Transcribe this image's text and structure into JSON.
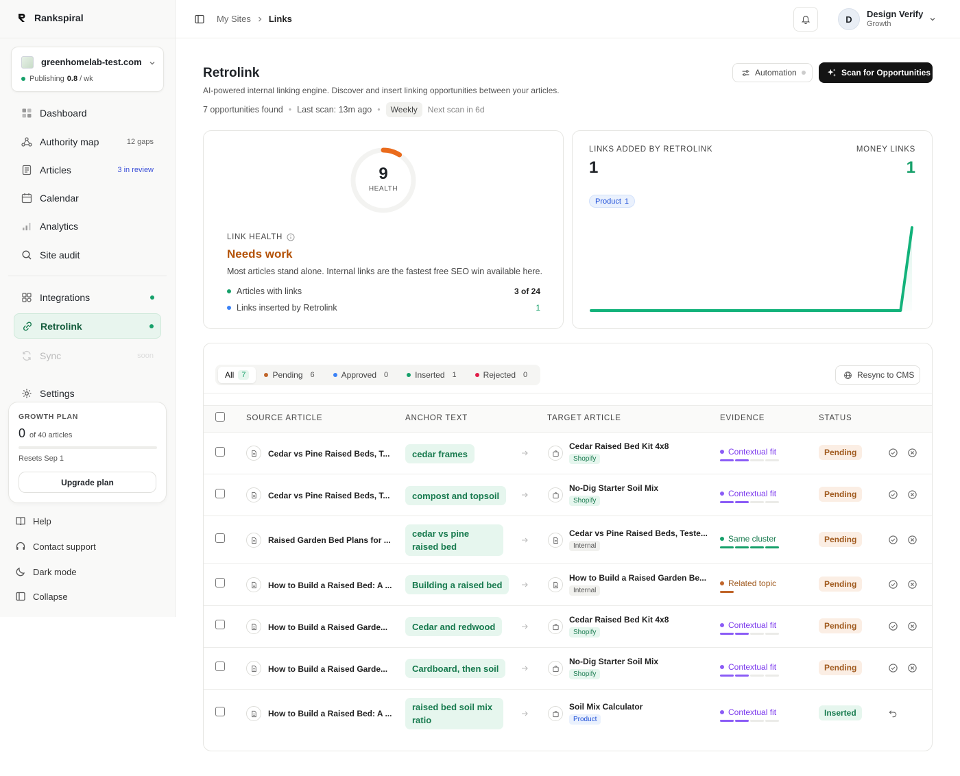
{
  "app": {
    "name": "Rankspiral"
  },
  "site": {
    "name": "greenhomelab-test.com",
    "publishing_label": "Publishing",
    "publishing_rate": "0.8",
    "publishing_unit": "/ wk"
  },
  "nav": {
    "items": [
      {
        "label": "Dashboard",
        "meta": "",
        "icon": "dashboard-icon"
      },
      {
        "label": "Authority map",
        "meta": "12 gaps",
        "icon": "authority-map-icon"
      },
      {
        "label": "Articles",
        "meta": "3 in review",
        "icon": "articles-icon"
      },
      {
        "label": "Calendar",
        "meta": "",
        "icon": "calendar-icon"
      },
      {
        "label": "Analytics",
        "meta": "",
        "icon": "analytics-icon"
      },
      {
        "label": "Site audit",
        "meta": "",
        "icon": "search-icon"
      },
      {
        "label": "Integrations",
        "meta": "",
        "icon": "integrations-icon"
      },
      {
        "label": "Retrolink",
        "meta": "",
        "icon": "link-icon"
      },
      {
        "label": "Sync",
        "meta": "soon",
        "icon": "sync-icon"
      },
      {
        "label": "Settings",
        "meta": "",
        "icon": "gear-icon"
      }
    ]
  },
  "plan": {
    "title": "GROWTH PLAN",
    "used": "0",
    "of_label": "of 40 articles",
    "progress": 0,
    "resets": "Resets Sep 1",
    "upgrade_label": "Upgrade plan"
  },
  "bottom_nav": [
    "Help",
    "Contact support",
    "Dark mode",
    "Collapse"
  ],
  "breadcrumb": {
    "root": "My Sites",
    "current": "Links"
  },
  "user": {
    "initial": "D",
    "name": "Design Verify",
    "plan": "Growth"
  },
  "page": {
    "title": "Retrolink",
    "subtitle": "AI-powered internal linking engine. Discover and insert linking opportunities between your articles.",
    "opportunities": "7 opportunities found",
    "last_scan": "Last scan: 13m ago",
    "frequency": "Weekly",
    "next_scan": "Next scan in 6d",
    "automation_label": "Automation",
    "scan_label": "Scan for Opportunities"
  },
  "health": {
    "score": "9",
    "score_fraction": 0.09,
    "score_label": "HEALTH",
    "label": "LINK HEALTH",
    "status": "Needs work",
    "description": "Most articles stand alone. Internal links are the fastest free SEO win available here.",
    "stats": [
      {
        "label": "Articles with links",
        "value": "3 of 24",
        "color": "#16a06a"
      },
      {
        "label": "Links inserted by Retrolink",
        "value": "1",
        "color": "#3b82f6"
      }
    ]
  },
  "links_added": {
    "label": "LINKS ADDED BY RETROLINK",
    "value": "1",
    "money_label": "MONEY LINKS",
    "money_value": "1",
    "chip_label": "Product",
    "chip_count": "1"
  },
  "chart_data": {
    "type": "area",
    "values": [
      0,
      0,
      0,
      0,
      0,
      0,
      0,
      0,
      0,
      0,
      0,
      0,
      0,
      0,
      0,
      0,
      0,
      0,
      0,
      0,
      0,
      0,
      0,
      0,
      0,
      0,
      0,
      0,
      1
    ],
    "ylim": [
      0,
      1
    ],
    "color": "#12b27a"
  },
  "filters": [
    {
      "label": "All",
      "count": "7",
      "color": ""
    },
    {
      "label": "Pending",
      "count": "6",
      "color": "#c0652a"
    },
    {
      "label": "Approved",
      "count": "0",
      "color": "#3b82f6"
    },
    {
      "label": "Inserted",
      "count": "1",
      "color": "#16a06a"
    },
    {
      "label": "Rejected",
      "count": "0",
      "color": "#e11d48"
    }
  ],
  "resync_label": "Resync to CMS",
  "table": {
    "headers": {
      "source": "SOURCE ARTICLE",
      "anchor": "ANCHOR TEXT",
      "target": "TARGET ARTICLE",
      "evidence": "EVIDENCE",
      "status": "STATUS"
    },
    "rows": [
      {
        "source": "Cedar vs Pine Raised Beds, T...",
        "anchor": "cedar frames",
        "target": "Cedar Raised Bed Kit 4x8",
        "tag": "Shopify",
        "evidence": "Contextual fit",
        "status": "Pending"
      },
      {
        "source": "Cedar vs Pine Raised Beds, T...",
        "anchor": "compost and topsoil",
        "target": "No-Dig Starter Soil Mix",
        "tag": "Shopify",
        "evidence": "Contextual fit",
        "status": "Pending"
      },
      {
        "source": "Raised Garden Bed Plans for ...",
        "anchor": "cedar vs pine raised bed",
        "target": "Cedar vs Pine Raised Beds, Teste...",
        "tag": "Internal",
        "evidence": "Same cluster",
        "status": "Pending"
      },
      {
        "source": "How to Build a Raised Bed: A ...",
        "anchor": "Building a raised bed",
        "target": "How to Build a Raised Garden Be...",
        "tag": "Internal",
        "evidence": "Related topic",
        "status": "Pending"
      },
      {
        "source": "How to Build a Raised Garde...",
        "anchor": "Cedar and redwood",
        "target": "Cedar Raised Bed Kit 4x8",
        "tag": "Shopify",
        "evidence": "Contextual fit",
        "status": "Pending"
      },
      {
        "source": "How to Build a Raised Garde...",
        "anchor": "Cardboard, then soil",
        "target": "No-Dig Starter Soil Mix",
        "tag": "Shopify",
        "evidence": "Contextual fit",
        "status": "Pending"
      },
      {
        "source": "How to Build a Raised Bed: A ...",
        "anchor": "raised bed soil mix ratio",
        "target": "Soil Mix Calculator",
        "tag": "Product",
        "evidence": "Contextual fit",
        "status": "Inserted"
      }
    ]
  }
}
